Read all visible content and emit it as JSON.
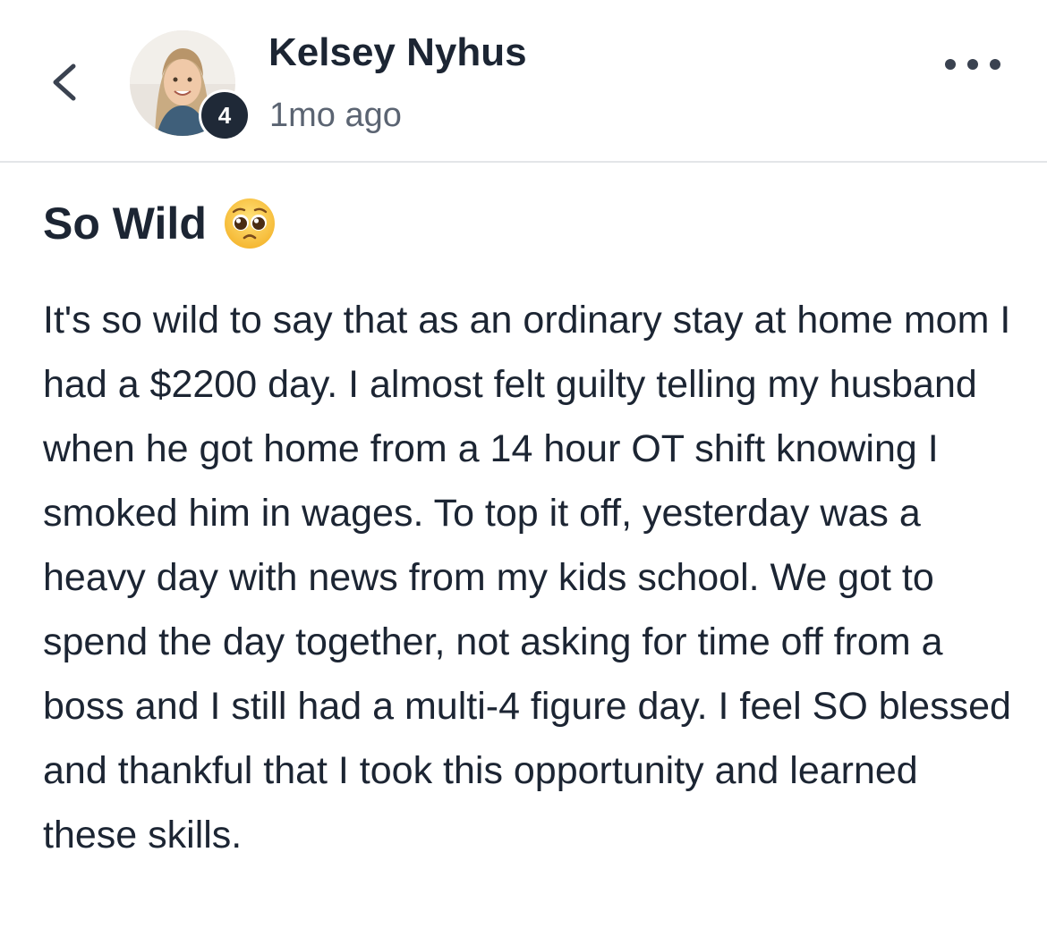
{
  "header": {
    "author_name": "Kelsey Nyhus",
    "timestamp": "1mo ago",
    "level_badge": "4",
    "icons": {
      "back": "chevron-left-icon",
      "more": "more-horizontal-icon"
    }
  },
  "post": {
    "title": "So Wild",
    "title_emoji": "pleading-face-emoji",
    "body": "It's so wild to say that as an ordinary stay at home mom I had a $2200 day. I almost felt guilty telling my husband when he got home from a 14 hour OT shift knowing I smoked him in wages. To top it off, yesterday was a heavy day with news from my kids school. We got to spend the day together, not asking for time off from a boss and I still had a multi-4 figure day. I feel SO blessed and thankful that I took this opportunity and learned these skills."
  },
  "colors": {
    "text": "#1c2533",
    "muted": "#5b6472",
    "badge": "#1f2937",
    "divider": "#e3e5e8"
  }
}
